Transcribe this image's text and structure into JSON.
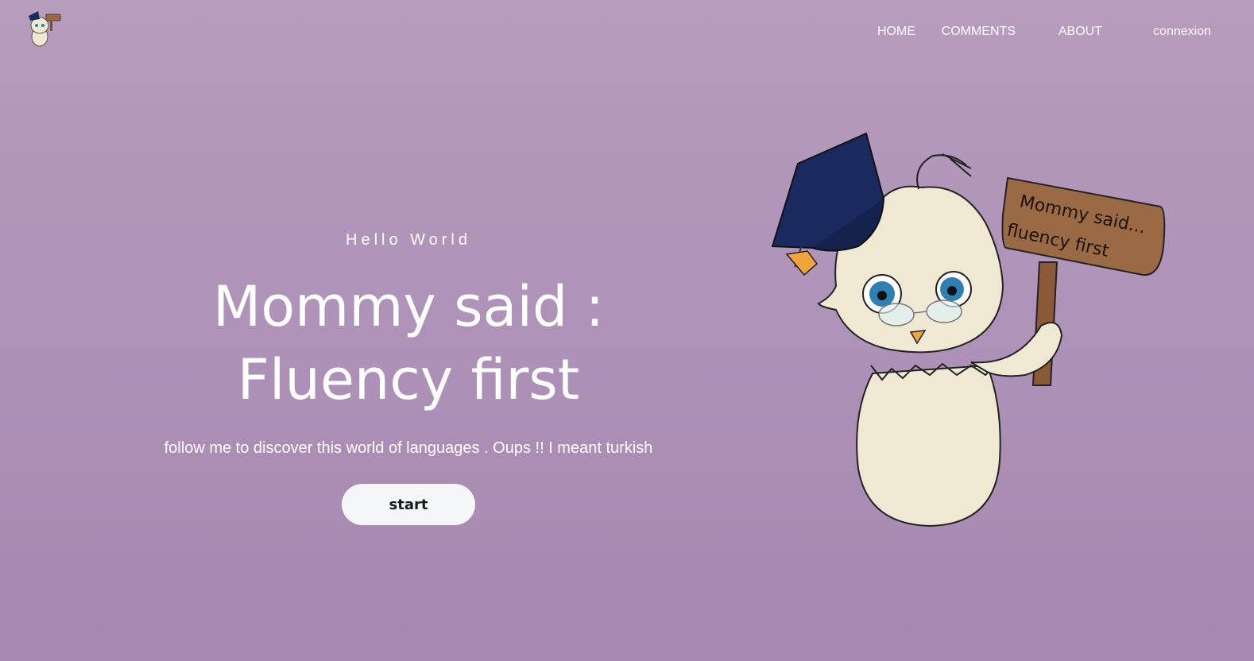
{
  "brand": {
    "logo_icon": "chick-mascot-logo-icon"
  },
  "nav": {
    "items": [
      {
        "label": "HOME"
      },
      {
        "label": "COMMENTS"
      },
      {
        "label": "ABOUT"
      },
      {
        "label": "connexion"
      }
    ]
  },
  "hero": {
    "eyebrow": "Hello World",
    "headline_line1": "Mommy said :",
    "headline_line2": "Fluency first",
    "subtitle": "follow me to discover this world of languages . Oups !! I meant turkish",
    "start_label": "start"
  },
  "mascot": {
    "icon": "chick-graduate-mascot-illustration",
    "sign_line1": "Mommy said...",
    "sign_line2": "fluency first"
  },
  "colors": {
    "background_top": "#b69cbd",
    "background_bottom": "#a887b0",
    "text": "#ffffff",
    "button_bg": "#f5f6f7",
    "button_text": "#1a1a1a",
    "cap": "#1b2a5e",
    "sign": "#9a6a45",
    "chick": "#efe9d4"
  }
}
